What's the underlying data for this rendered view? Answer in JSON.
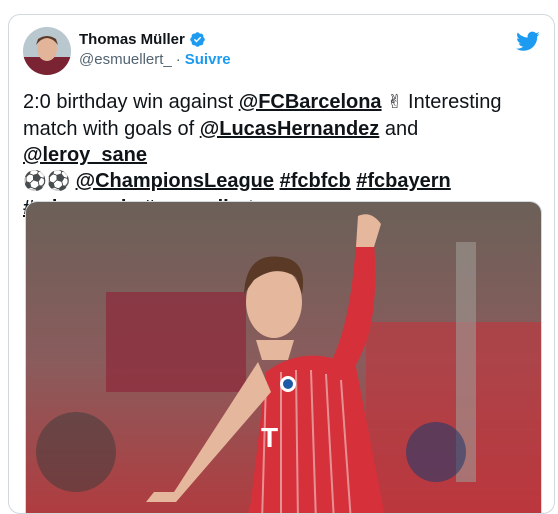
{
  "author": {
    "name": "Thomas Müller",
    "handle": "@esmuellert_",
    "separator": "·",
    "follow_label": "Suivre"
  },
  "icons": {
    "verified": "verified-badge-icon",
    "brand": "twitter-bird-icon",
    "accent_color": "#1d9bf0"
  },
  "tweet": {
    "t1": "2:0 birthday win against ",
    "m1": "@FCBarcelona",
    "e1": " ✌ ",
    "t2": "Interesting match with goals of ",
    "m2": "@LucasHernandez",
    "t3": " and ",
    "m3": "@leroy_sane",
    "e2": "⚽⚽ ",
    "m4": "@ChampionsLeague",
    "h1": "#fcbfcb",
    "h2": "#fcbayern",
    "h3": "#miasanmia",
    "h4": "#esmuellert"
  }
}
